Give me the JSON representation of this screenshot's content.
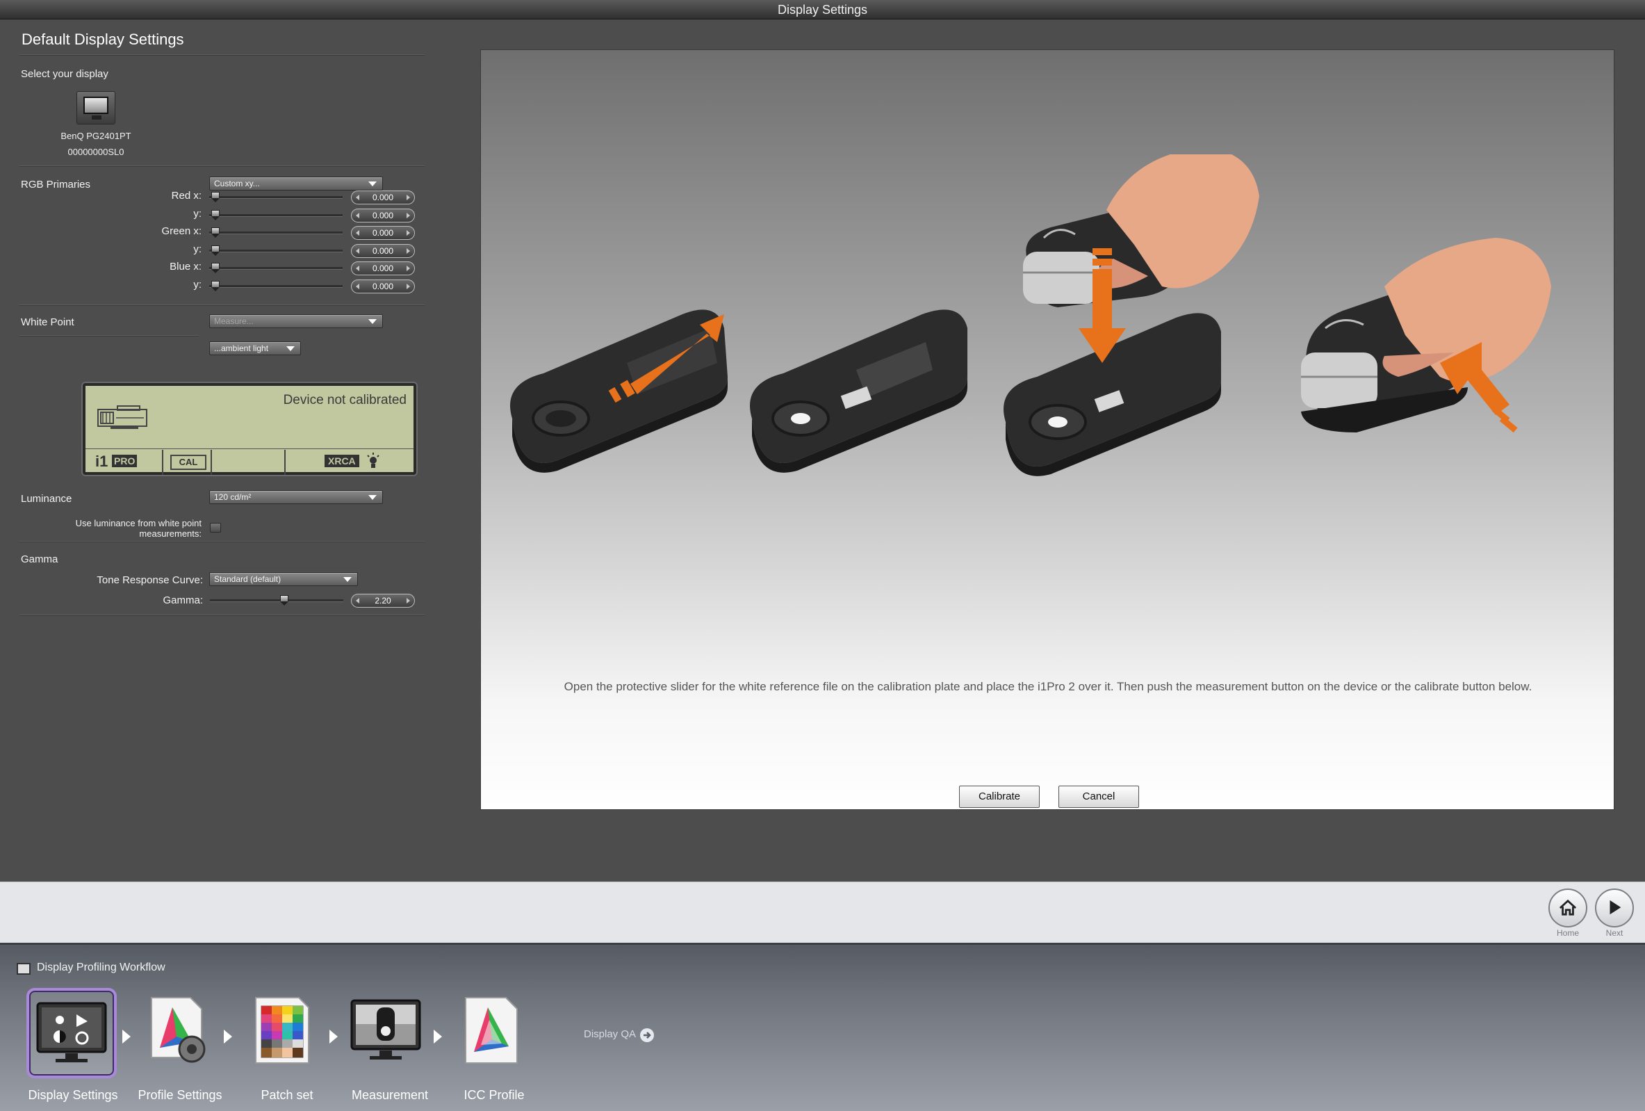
{
  "window": {
    "title": "Display Settings"
  },
  "left_panel": {
    "title": "Default Display Settings",
    "select_display_label": "Select your display",
    "display": {
      "name": "BenQ PG2401PT",
      "serial": "00000000SL0",
      "icon": "monitor-icon"
    },
    "rgb_primaries": {
      "label": "RGB Primaries",
      "dropdown_value": "Custom xy...",
      "rows": [
        {
          "label": "Red x:",
          "value": "0.000"
        },
        {
          "label": "y:",
          "value": "0.000"
        },
        {
          "label": "Green x:",
          "value": "0.000"
        },
        {
          "label": "y:",
          "value": "0.000"
        },
        {
          "label": "Blue x:",
          "value": "0.000"
        },
        {
          "label": "y:",
          "value": "0.000"
        }
      ]
    },
    "white_point": {
      "label": "White Point",
      "dropdown_value": "Measure...",
      "sub_dropdown_value": "...ambient light"
    },
    "lcd": {
      "message": "Device not calibrated",
      "i1": "i1",
      "pro": "PRO",
      "cal": "CAL",
      "xrca": "XRCA"
    },
    "luminance": {
      "label": "Luminance",
      "dropdown_value": "120 cd/m²",
      "checkbox_label_line1": "Use luminance from white point",
      "checkbox_label_line2": "measurements:",
      "checked": false
    },
    "gamma": {
      "label": "Gamma",
      "trc_label": "Tone Response Curve:",
      "trc_value": "Standard (default)",
      "gamma_label": "Gamma:",
      "gamma_value": "2.20"
    }
  },
  "main_panel": {
    "instruction": "Open the protective slider for the white reference file on the calibration plate and place the i1Pro 2 over it. Then push the measurement button on the device or the calibrate button below.",
    "calibrate_label": "Calibrate",
    "cancel_label": "Cancel"
  },
  "navbar": {
    "home_label": "Home",
    "next_label": "Next"
  },
  "workflow": {
    "title": "Display Profiling Workflow",
    "steps": [
      {
        "label": "Display Settings",
        "icon": "display-settings-icon",
        "active": true
      },
      {
        "label": "Profile Settings",
        "icon": "profile-settings-icon",
        "active": false
      },
      {
        "label": "Patch set",
        "icon": "patch-set-icon",
        "active": false
      },
      {
        "label": "Measurement",
        "icon": "measurement-icon",
        "active": false
      },
      {
        "label": "ICC Profile",
        "icon": "icc-profile-icon",
        "active": false
      }
    ],
    "display_qa_label": "Display QA"
  },
  "colors": {
    "accent_orange": "#e8711c",
    "active_step_border": "#a98ad8"
  }
}
